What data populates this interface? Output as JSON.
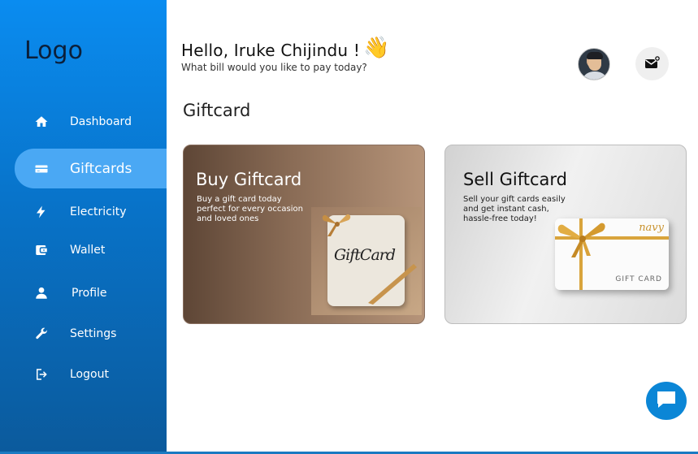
{
  "sidebar": {
    "logo": "Logo",
    "items": [
      {
        "label": "Dashboard",
        "icon": "home-icon"
      },
      {
        "label": "Giftcards",
        "icon": "card-icon",
        "active": true
      },
      {
        "label": "Electricity",
        "icon": "bolt-icon"
      },
      {
        "label": "Wallet",
        "icon": "wallet-icon"
      },
      {
        "label": "Profile",
        "icon": "person-icon"
      },
      {
        "label": "Settings",
        "icon": "wrench-icon"
      },
      {
        "label": "Logout",
        "icon": "logout-icon"
      }
    ]
  },
  "header": {
    "greeting": "Hello, Iruke Chijindu !",
    "wave_emoji": "👋",
    "subtitle": "What bill would you like to pay today?"
  },
  "main": {
    "section_title": "Giftcard",
    "cards": [
      {
        "title": "Buy Giftcard",
        "description": "Buy a gift card today perfect for every occasion and loved ones",
        "art_text": "GiftCard"
      },
      {
        "title": "Sell Giftcard",
        "description": "Sell your gift cards easily and get instant cash, hassle-free today!",
        "art_brand": "navy",
        "art_label": "GIFT CARD"
      }
    ]
  },
  "colors": {
    "sidebar_top": "#0a8cf0",
    "sidebar_bottom": "#0b5a9c",
    "active_item": "#4aa8f4",
    "chat_button": "#0b86d6"
  }
}
